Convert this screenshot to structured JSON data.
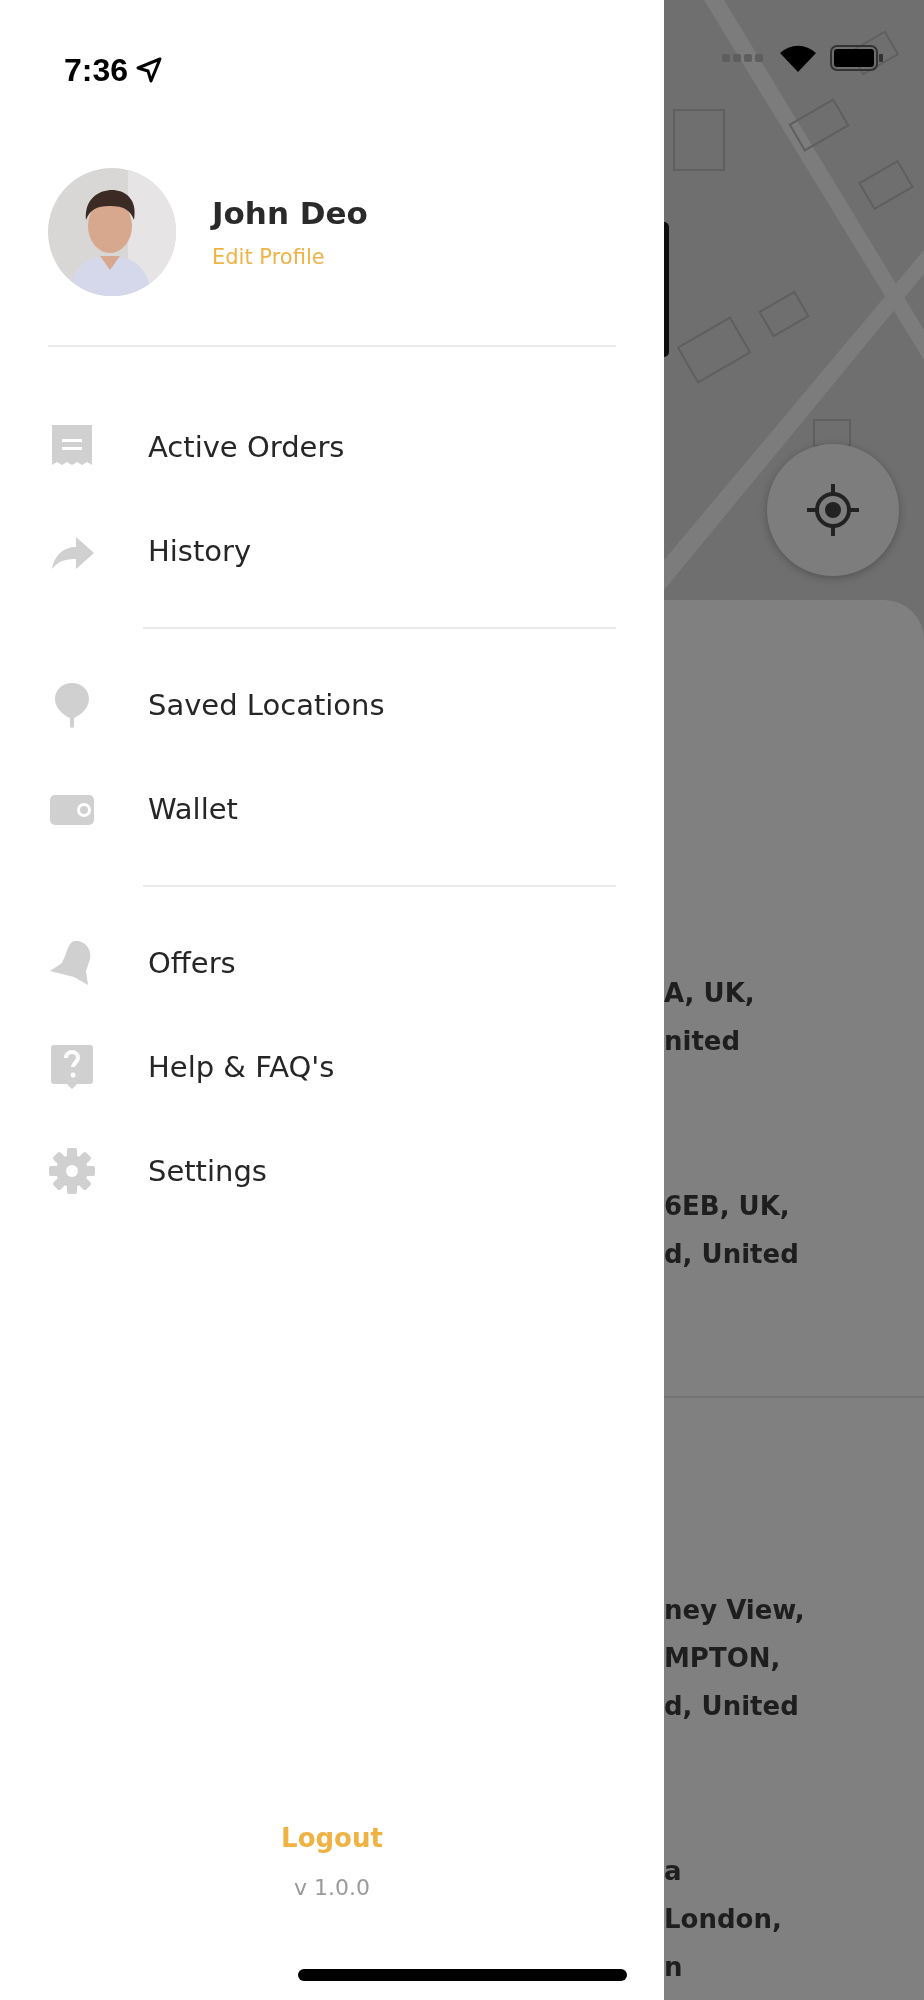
{
  "status_bar": {
    "time": "7:36"
  },
  "profile": {
    "name": "John Deo",
    "edit_link": "Edit Profile"
  },
  "menu_groups": [
    [
      {
        "kind": "receipt",
        "label": "Active Orders"
      },
      {
        "kind": "share",
        "label": "History"
      }
    ],
    [
      {
        "kind": "pin",
        "label": "Saved Locations"
      },
      {
        "kind": "wallet",
        "label": "Wallet"
      }
    ],
    [
      {
        "kind": "bell",
        "label": "Offers"
      },
      {
        "kind": "help",
        "label": "Help & FAQ's"
      },
      {
        "kind": "gear",
        "label": "Settings"
      }
    ]
  ],
  "footer": {
    "logout": "Logout",
    "version": "v 1.0.0"
  },
  "background": {
    "address_groups": [
      [
        "A, UK,",
        "nited"
      ],
      [
        "6EB, UK,",
        "d, United"
      ],
      [
        "ney View,",
        "MPTON,",
        "d, United"
      ],
      [
        "a",
        "London,",
        "n"
      ]
    ]
  }
}
